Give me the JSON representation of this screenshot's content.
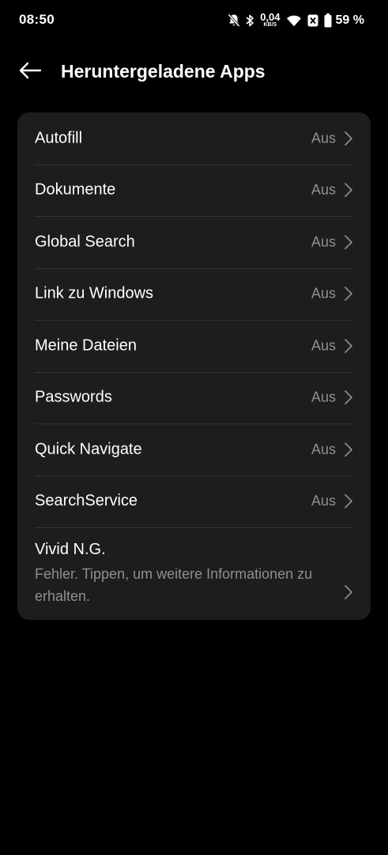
{
  "status_bar": {
    "time": "08:50",
    "net_speed_value": "0,04",
    "net_speed_unit": "KB/S",
    "battery": "59 %",
    "icons": [
      "bell-off-icon",
      "bluetooth-icon",
      "wifi-icon",
      "battery-saver-icon",
      "battery-icon"
    ]
  },
  "header": {
    "title": "Heruntergeladene Apps",
    "back_icon": "arrow-left-icon"
  },
  "apps": [
    {
      "name": "Autofill",
      "status": "Aus"
    },
    {
      "name": "Dokumente",
      "status": "Aus"
    },
    {
      "name": "Global Search",
      "status": "Aus"
    },
    {
      "name": "Link zu Windows",
      "status": "Aus"
    },
    {
      "name": "Meine Dateien",
      "status": "Aus"
    },
    {
      "name": "Passwords",
      "status": "Aus"
    },
    {
      "name": "Quick Navigate",
      "status": "Aus"
    },
    {
      "name": "SearchService",
      "status": "Aus"
    }
  ],
  "error_app": {
    "name": "Vivid N.G.",
    "description": "Fehler. Tippen, um weitere Informationen zu erhalten."
  },
  "colors": {
    "background": "#000000",
    "card": "#1d1d1d",
    "divider": "#333333",
    "secondary_text": "#8f8f8f",
    "chevron": "#8a8a8a"
  }
}
